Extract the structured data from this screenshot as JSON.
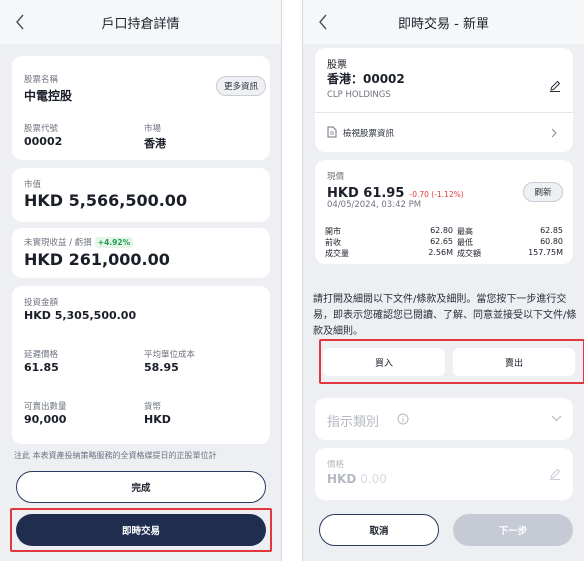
{
  "left": {
    "nav_title": "戶口持倉詳情",
    "stock_name_label": "股票名稱",
    "stock_name": "中電控股",
    "more_info": "更多資訊",
    "code_label": "股票代號",
    "code": "00002",
    "market_label": "市場",
    "market": "香港",
    "market_value_label": "市值",
    "market_value": "HKD 5,566,500.00",
    "pnl_label": "未實現收益 / 虧損",
    "pnl_pct": "+4.92%",
    "pnl_value": "HKD 261,000.00",
    "invest_label": "投資金額",
    "invest_value": "HKD 5,305,500.00",
    "delayed_label": "延遲價格",
    "delayed_value": "61.85",
    "avg_cost_label": "平均單位成本",
    "avg_cost_value": "58.95",
    "sellable_label": "可賣出數量",
    "sellable_value": "90,000",
    "currency_label": "貨幣",
    "currency_value": "HKD",
    "disclaimer": "注此 本表資產投納策略服務的全資格媒提日的正股單位計",
    "done_button": "完成",
    "trade_button": "即時交易"
  },
  "right": {
    "nav_title": "即時交易 - 新單",
    "stock_label": "股票",
    "stock_code": "香港：00002",
    "stock_en": "CLP HOLDINGS",
    "view_info": "檢視股票資訊",
    "price_label": "現價",
    "price": "HKD 61.95",
    "price_change": "-0.70 (-1.12%)",
    "timestamp": "04/05/2024, 03:42 PM",
    "refresh": "刷新",
    "market_rows": [
      {
        "l1": "開市",
        "v1": "62.80",
        "l2": "最高",
        "v2": "62.85"
      },
      {
        "l1": "前收",
        "v1": "62.65",
        "l2": "最低",
        "v2": "60.80"
      },
      {
        "l1": "成交量",
        "v1": "2.56M",
        "l2": "成交額",
        "v2": "157.75M"
      }
    ],
    "notice": "請打開及細閱以下文件/條款及細則。當您按下一步進行交易，即表示您確認您已閱讀、了解、同意並接受以下文件/條款及細則。",
    "buy": "買入",
    "sell": "賣出",
    "order_type": "指示類別",
    "price_field_label": "價格",
    "price_field_ccy": "HKD",
    "price_field_placeholder": "0.00",
    "cancel": "取消",
    "next": "下一步"
  },
  "colors": {
    "navy": "#1f2e4f",
    "alert_red": "#e0383e",
    "gain_green": "#1f9d4c",
    "loss_red": "#e0383e"
  }
}
